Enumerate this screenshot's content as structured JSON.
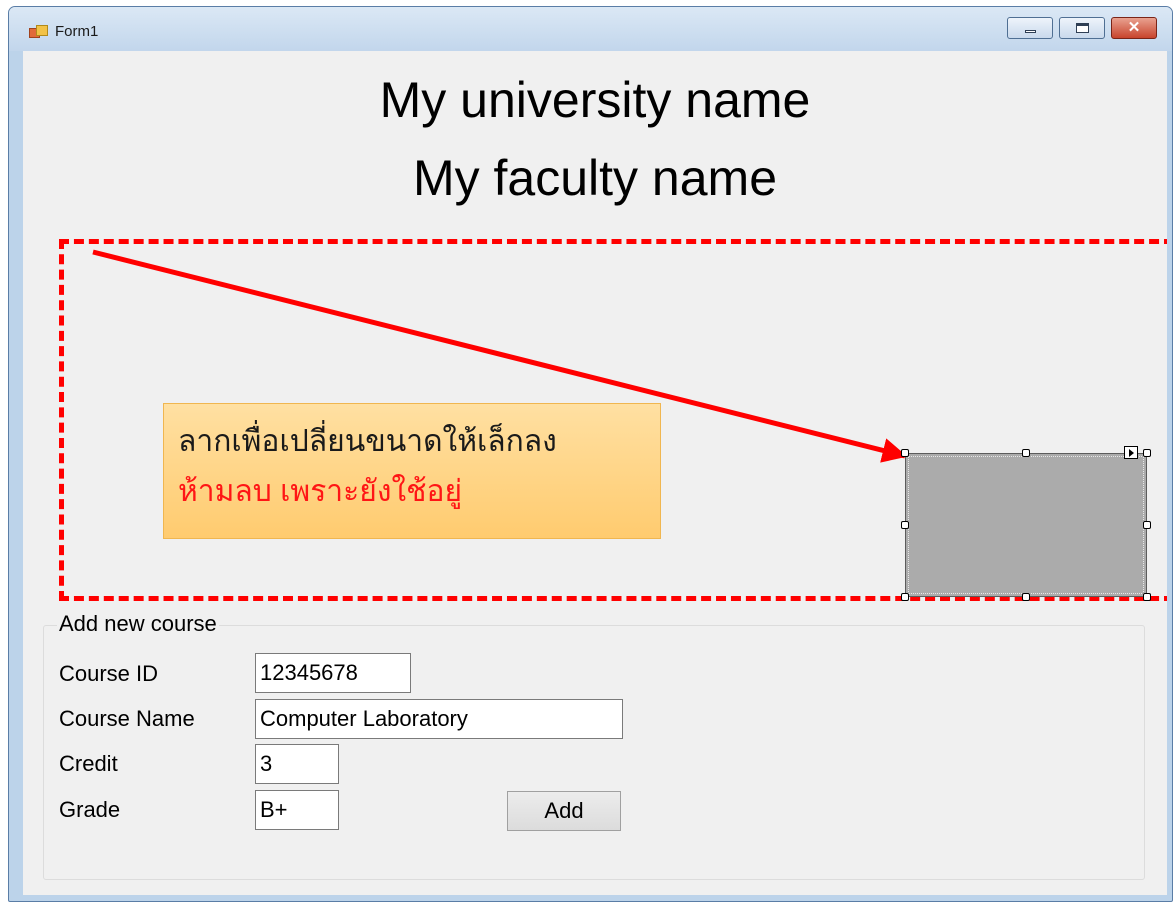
{
  "window": {
    "title": "Form1",
    "controls": {
      "minimize": "minimize",
      "maximize": "maximize",
      "close": "✕"
    }
  },
  "header": {
    "university": "My university name",
    "faculty": "My faculty name"
  },
  "annotation": {
    "line1": "ลากเพื่อเปลี่ยนขนาดให้เล็กลง",
    "line2": "ห้ามลบ เพราะยังใช้อยู่",
    "colors": {
      "outline": "#ff0000",
      "callout_fill": "#ffd483",
      "warning_text": "#ff1515"
    }
  },
  "form": {
    "group_title": "Add new course",
    "fields": {
      "course_id": {
        "label": "Course ID",
        "value": "12345678"
      },
      "course_name": {
        "label": "Course Name",
        "value": "Computer Laboratory"
      },
      "credit": {
        "label": "Credit",
        "value": "3"
      },
      "grade": {
        "label": "Grade",
        "value": "B+"
      }
    },
    "add_button": "Add"
  }
}
